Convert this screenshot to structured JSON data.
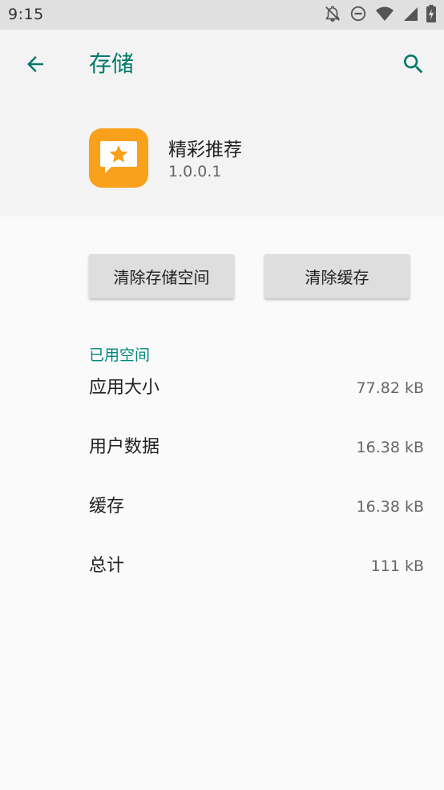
{
  "status_bar": {
    "time": "9:15"
  },
  "toolbar": {
    "title": "存储"
  },
  "app": {
    "name": "精彩推荐",
    "version": "1.0.0.1",
    "icon_color": "#f9a11b"
  },
  "actions": {
    "clear_storage_label": "清除存储空间",
    "clear_cache_label": "清除缓存"
  },
  "usage": {
    "section_title": "已用空间",
    "rows": [
      {
        "label": "应用大小",
        "value": "77.82 kB"
      },
      {
        "label": "用户数据",
        "value": "16.38 kB"
      },
      {
        "label": "缓存",
        "value": "16.38 kB"
      },
      {
        "label": "总计",
        "value": "111 kB"
      }
    ]
  },
  "colors": {
    "accent": "#00796b",
    "section_accent": "#00897b"
  }
}
